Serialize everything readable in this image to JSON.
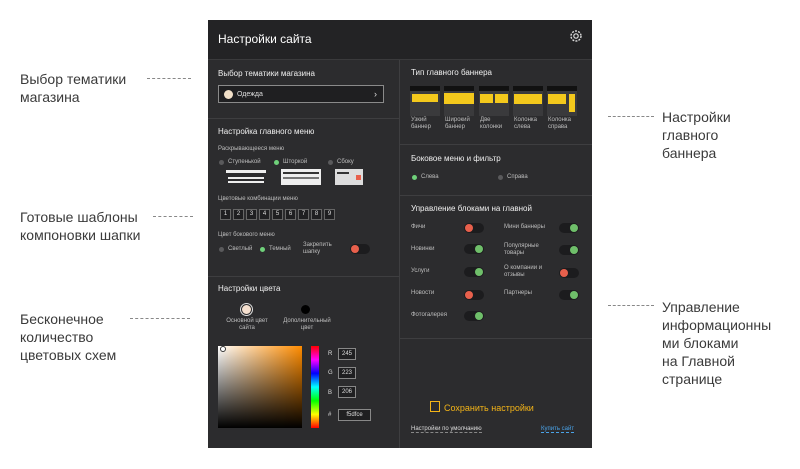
{
  "annotations": {
    "theme": "Выбор тематики\nмагазина",
    "templates": "Готовые шаблоны\nкомпоновки шапки",
    "colors": "Бесконечное\nколичество\nцветовых схем",
    "banner": "Настройки\nглавного\nбаннера",
    "blocks": "Управление\nинформационны\nми блоками\nна Главной\nстранице"
  },
  "panel": {
    "title": "Настройки сайта",
    "gear_icon": "gear-icon"
  },
  "theme": {
    "title": "Выбор тематики магазина",
    "value": "Одежда",
    "dot_color": "#f1dfc8"
  },
  "menu": {
    "title": "Настройка главного меню",
    "dropdown_label": "Раскрывающееся меню",
    "options": [
      "Ступенькой",
      "Шторкой",
      "Сбоку"
    ],
    "selected": "Шторкой",
    "combos_label": "Цветовые комбинации меню",
    "combos": [
      "1",
      "2",
      "3",
      "4",
      "5",
      "6",
      "7",
      "8",
      "9"
    ],
    "side_color_label": "Цвет бокового меню",
    "side_options": [
      "Светлый",
      "Темный"
    ],
    "side_selected": "Темный",
    "pin_label": "Закрепить\nшапку"
  },
  "color": {
    "title": "Настройки цвета",
    "main_label": "Основной цвет\nсайта",
    "extra_label": "Дополнительный\nцвет",
    "main_color": "#f5dfce",
    "extra_color": "#000000",
    "r_label": "R",
    "r": "245",
    "g_label": "G",
    "g": "223",
    "b_label": "B",
    "b": "206",
    "hash_label": "#",
    "hex": "f5dfce"
  },
  "banner": {
    "title": "Тип главного баннера",
    "types": [
      "Узкий\nбаннер",
      "Широкий\nбаннер",
      "Две\nколонки",
      "Колонка\nслева",
      "Колонка\nсправа"
    ],
    "accent": "#f3c81c"
  },
  "side_menu": {
    "title": "Боковое меню и фильтр",
    "options": [
      "Слева",
      "Справа"
    ],
    "selected": "Слева"
  },
  "blocks": {
    "title": "Управление блоками на главной",
    "left": [
      {
        "label": "Фичи",
        "on": false
      },
      {
        "label": "Новинки",
        "on": true
      },
      {
        "label": "Услуги",
        "on": true
      },
      {
        "label": "Новости",
        "on": false
      },
      {
        "label": "Фотогалерея",
        "on": true
      }
    ],
    "right": [
      {
        "label": "Мини баннеры",
        "on": true
      },
      {
        "label": "Популярные\nтовары",
        "on": true
      },
      {
        "label": "О компании и\nотзывы",
        "on": false
      },
      {
        "label": "Партнеры",
        "on": true
      }
    ]
  },
  "footer": {
    "save": "Сохранить настройки",
    "defaults": "Настройки по умолчанию",
    "buy": "Купить сайт"
  }
}
